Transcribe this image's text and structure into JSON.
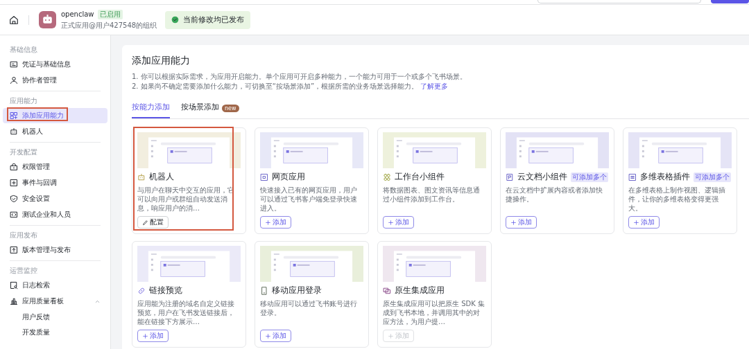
{
  "header": {
    "app_name": "openclaw",
    "app_status": "已启用",
    "app_org": "正式应用@用户427548的组织",
    "publish_status": "当前修改均已发布"
  },
  "sidebar": {
    "sections": [
      {
        "title": "基础信息",
        "items": [
          {
            "label": "凭证与基础信息",
            "selected": false,
            "annotated": false
          },
          {
            "label": "协作者管理",
            "selected": false,
            "annotated": false
          }
        ]
      },
      {
        "title": "应用能力",
        "items": [
          {
            "label": "添加应用能力",
            "selected": true,
            "annotated": true
          },
          {
            "label": "机器人",
            "selected": false,
            "annotated": false
          }
        ]
      },
      {
        "title": "开发配置",
        "items": [
          {
            "label": "权限管理",
            "selected": false,
            "annotated": false
          },
          {
            "label": "事件与回调",
            "selected": false,
            "annotated": false
          },
          {
            "label": "安全设置",
            "selected": false,
            "annotated": false
          },
          {
            "label": "测试企业和人员",
            "selected": false,
            "annotated": false
          }
        ]
      },
      {
        "title": "应用发布",
        "items": [
          {
            "label": "版本管理与发布",
            "selected": false,
            "annotated": false
          }
        ]
      },
      {
        "title": "运营监控",
        "items": [
          {
            "label": "日志检索",
            "selected": false,
            "annotated": false
          },
          {
            "label": "应用质量看板",
            "selected": false,
            "annotated": false,
            "expanded": true,
            "children": [
              {
                "label": "用户反馈",
                "selected": false
              },
              {
                "label": "开发质量",
                "selected": false
              }
            ]
          }
        ]
      }
    ]
  },
  "content": {
    "title": "添加应用能力",
    "notes": [
      "1. 你可以根据实际需求，为应用开启能力。单个应用可开启多种能力，一个能力可用于一个或多个飞书场景。",
      "2. 如果尚不确定需要添加什么能力，可切换至“按场景添加”，根据所需的业务场景选择能力。"
    ],
    "learn_more": "了解更多",
    "tabs": [
      {
        "label": "按能力添加",
        "selected": true
      },
      {
        "label": "按场景添加",
        "selected": false,
        "badge": "new"
      }
    ],
    "cards": [
      {
        "title": "机器人",
        "description": "与用户在聊天中交互的应用，它可以向用户或群组自动发送消息，响应用户的消…",
        "color": "#f2eedf",
        "annotated": true,
        "button": {
          "kind": "configure",
          "label": "配置",
          "disabled": false
        }
      },
      {
        "title": "网页应用",
        "description": "快速接入已有的网页应用，用户可以通过飞书客户端免登录快速进入。",
        "color": "#e7e8f7",
        "annotated": false,
        "button": {
          "kind": "add",
          "label": "添加",
          "disabled": false
        }
      },
      {
        "title": "工作台小组件",
        "description": "将数据图表、图文资讯等信息通过小组件添加到工作台。",
        "color": "#eef1dc",
        "annotated": false,
        "button": {
          "kind": "add",
          "label": "添加",
          "disabled": false
        }
      },
      {
        "title": "云文档小组件",
        "tag": "可添加多个",
        "description": "在云文档中扩展内容或者添加快捷操作。",
        "color": "#e3e2f5",
        "annotated": false,
        "button": {
          "kind": "add",
          "label": "添加",
          "disabled": false
        }
      },
      {
        "title": "多维表格插件",
        "tag": "可添加多个",
        "description": "在多维表格上制作视图、逻辑插件，让你的多维表格变得更强大。",
        "color": "#e5e4f6",
        "annotated": false,
        "button": {
          "kind": "add",
          "label": "添加",
          "disabled": false
        }
      },
      {
        "title": "链接预览",
        "description": "应用能为注册的域名自定义链接预览，用户在飞书发送链接后，能在链接下方展示…",
        "color": "#ebeaf8",
        "annotated": false,
        "button": {
          "kind": "add",
          "label": "添加",
          "disabled": false
        }
      },
      {
        "title": "移动应用登录",
        "description": "移动应用可以通过飞书账号进行登录。",
        "color": "#e9efdb",
        "annotated": false,
        "button": {
          "kind": "add",
          "label": "添加",
          "disabled": false
        }
      },
      {
        "title": "原生集成应用",
        "description": "原生集成应用可以把原生 SDK 集成到飞书本地，并调用其中的对应方法，为用户提…",
        "color": "#efe7ef",
        "annotated": false,
        "button": {
          "kind": "add",
          "label": "添加",
          "disabled": true
        }
      }
    ]
  }
}
